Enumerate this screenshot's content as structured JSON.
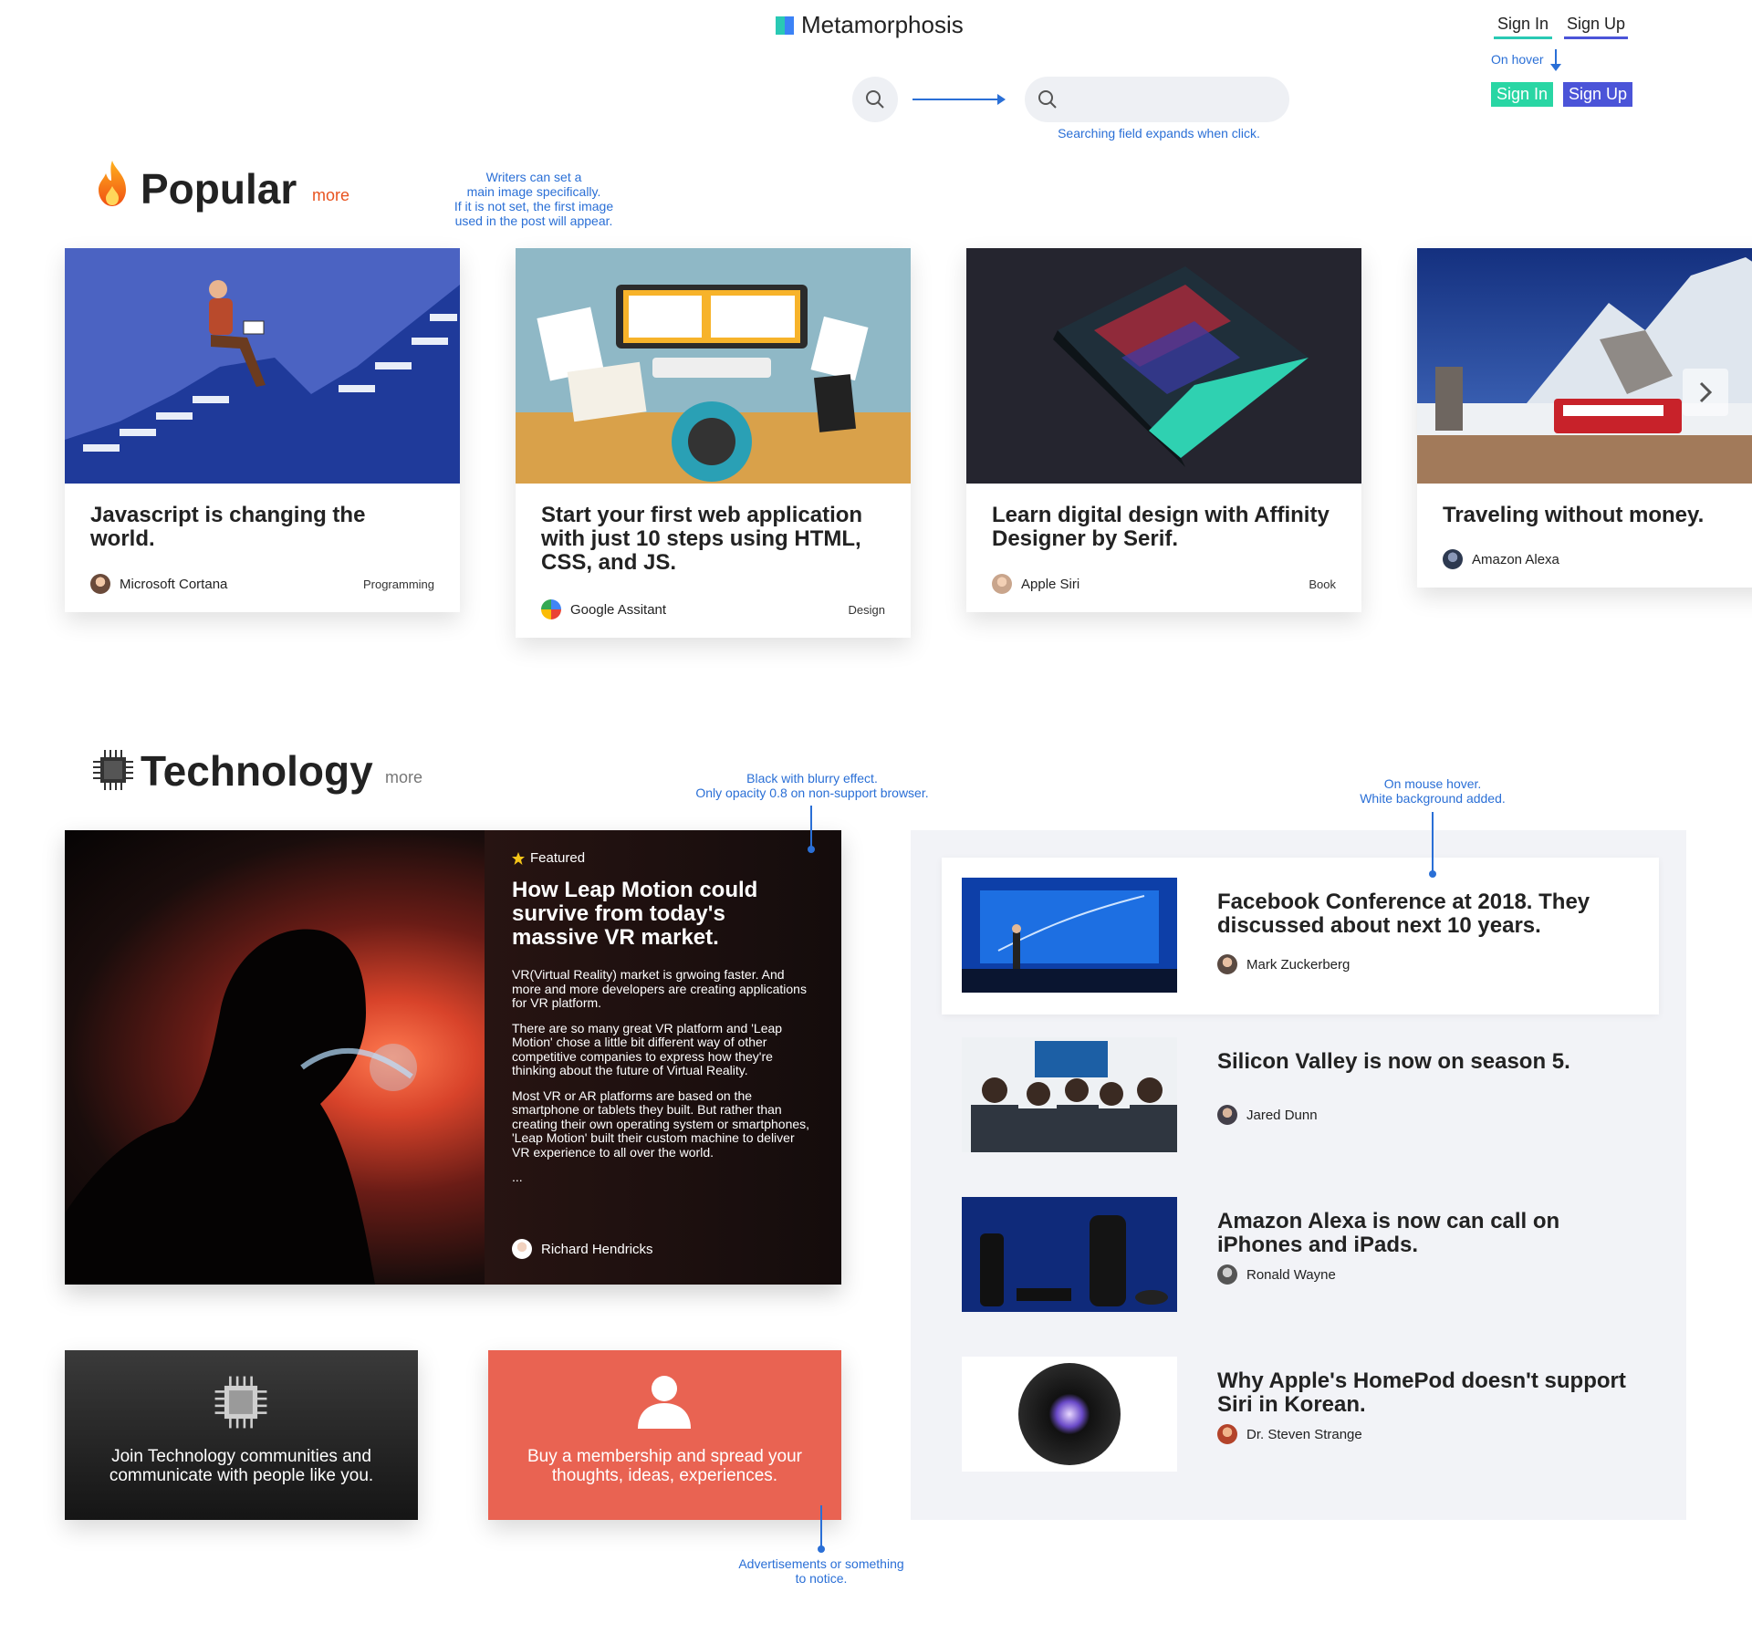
{
  "header": {
    "brand": "Metamorphosis",
    "sign_in": "Sign In",
    "sign_up": "Sign Up",
    "hover_note": "On hover",
    "sign_in_hover": "Sign In",
    "sign_up_hover": "Sign Up",
    "search_placeholder": "",
    "search_note": "Searching field expands when click."
  },
  "annotations": {
    "main_image": [
      "Writers can set a",
      "main image specifically.",
      "If it is not set, the first image",
      "used in the post will appear."
    ],
    "blur": [
      "Black with blurry effect.",
      "Only opacity 0.8 on non-support browser."
    ],
    "hover_bg": [
      "On mouse hover.",
      "White background added."
    ],
    "ads": [
      "Advertisements or something",
      "to notice."
    ]
  },
  "popular": {
    "title": "Popular",
    "more": "more",
    "cards": [
      {
        "title": "Javascript is changing the world.",
        "author": "Microsoft Cortana",
        "category": "Programming"
      },
      {
        "title": "Start your first web application with just 10 steps using HTML, CSS, and JS.",
        "author": "Google Assitant",
        "category": "Design"
      },
      {
        "title": "Learn digital design with Affinity Designer by Serif.",
        "author": "Apple Siri",
        "category": "Book"
      },
      {
        "title": "Traveling without money.",
        "author": "Amazon Alexa",
        "category": ""
      }
    ]
  },
  "technology": {
    "title": "Technology",
    "more": "more",
    "featured": {
      "tag": "Featured",
      "title": "How Leap Motion could survive from today's massive VR market.",
      "paragraphs": [
        "VR(Virtual Reality) market is grwoing faster. And more and more developers are creating applications for VR platform.",
        "There are so many great VR platform and 'Leap Motion' chose a little bit different way of other competitive companies to express how they're thinking about the future of Virtual Reality.",
        "Most VR or AR platforms are based on the smartphone or tablets they built. But rather than creating their own operating system or smartphones, 'Leap Motion' built their custom machine to deliver VR experience to all over the world.",
        "..."
      ],
      "author": "Richard Hendricks"
    },
    "join_box": "Join Technology communities and communicate with people like you.",
    "membership_box": "Buy a membership and spread your thoughts, ideas, experiences.",
    "list": [
      {
        "title": "Facebook Conference at 2018. They discussed about next 10 years.",
        "author": "Mark Zuckerberg"
      },
      {
        "title": "Silicon Valley is now on season 5.",
        "author": "Jared Dunn"
      },
      {
        "title": "Amazon Alexa is now can call on iPhones and iPads.",
        "author": "Ronald Wayne"
      },
      {
        "title": "Why Apple's HomePod doesn't support Siri in Korean.",
        "author": "Dr. Steven Strange"
      }
    ]
  },
  "colors": {
    "accent_teal": "#29c9b4",
    "accent_indigo": "#4b54d8",
    "annotation_blue": "#2a6fd6",
    "more_orange": "#e8531f",
    "ad_red": "#e96352"
  }
}
